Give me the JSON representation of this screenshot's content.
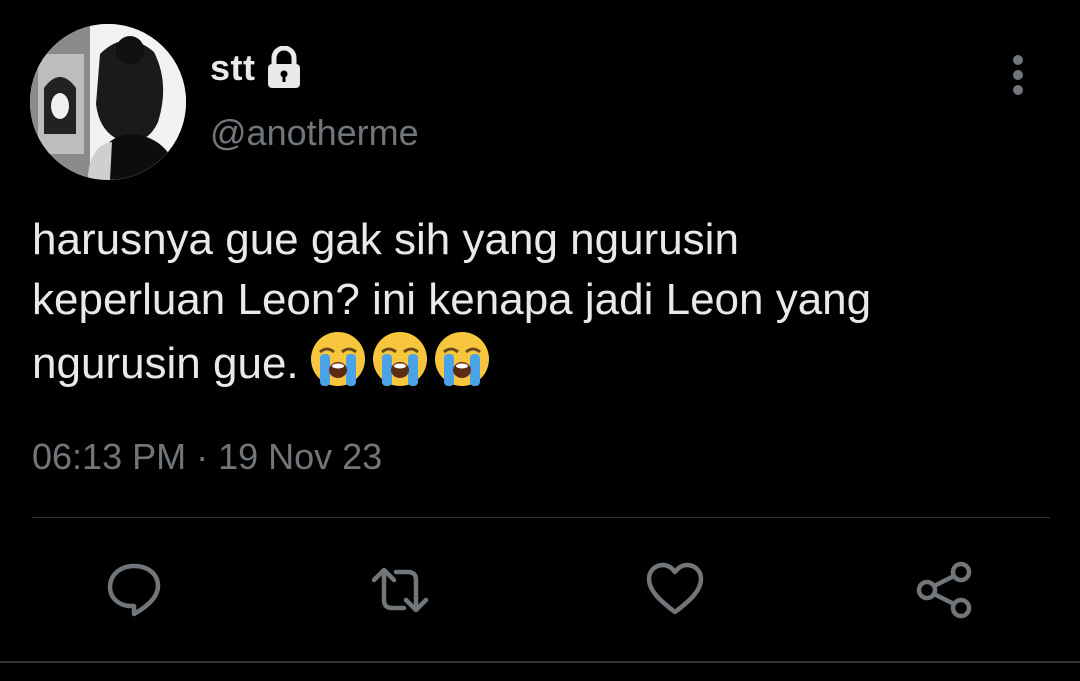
{
  "user": {
    "display_name": "stt",
    "handle": "@anotherme",
    "protected_icon": "lock-icon"
  },
  "tweet": {
    "text": "harusnya gue gak sih yang ngurusin\nkeperluan Leon? ini kenapa jadi Leon yang\nngurusin gue.",
    "emojis": [
      "loudly-crying-face",
      "loudly-crying-face",
      "loudly-crying-face"
    ],
    "timestamp": "06:13 PM · 19 Nov 23"
  },
  "actions": {
    "reply_icon": "reply-icon",
    "retweet_icon": "retweet-icon",
    "like_icon": "heart-icon",
    "share_icon": "share-icon",
    "more_icon": "more-vertical-icon"
  },
  "colors": {
    "background": "#000000",
    "primary_text": "#e7e9ea",
    "secondary_text": "#71767b",
    "divider": "#2f3336"
  }
}
